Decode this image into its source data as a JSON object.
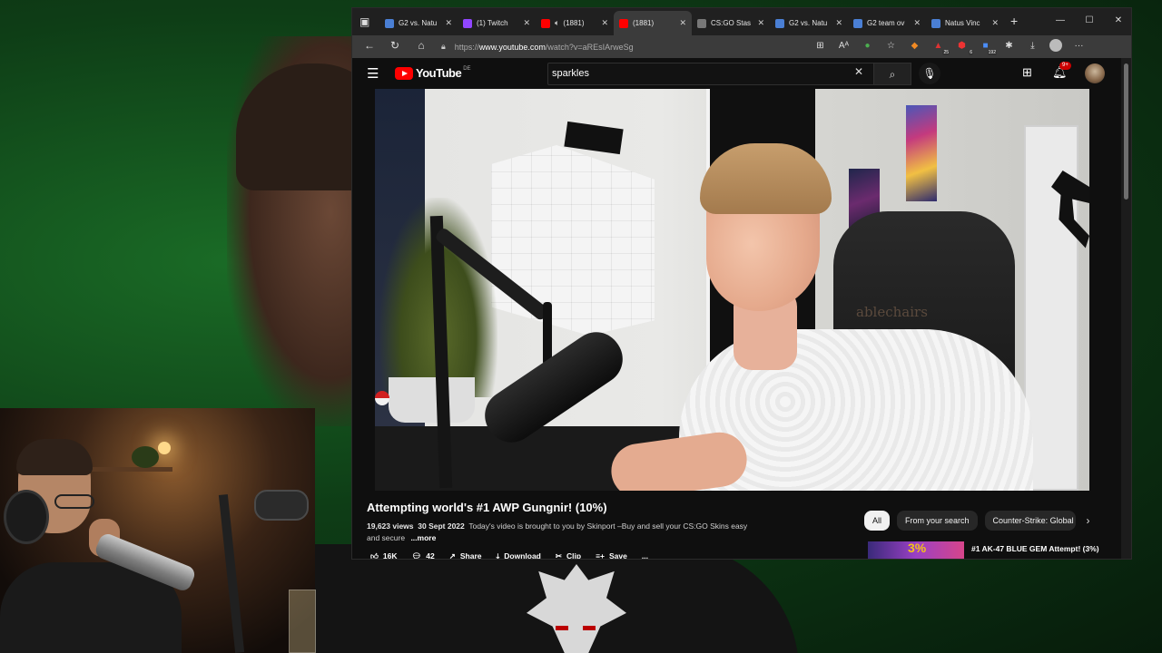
{
  "browser": {
    "tabs": [
      {
        "label": "G2 vs. Natu",
        "icon": "page-icon",
        "color": "#4a7fd4"
      },
      {
        "label": "(1) Twitch",
        "icon": "twitch-icon",
        "color": "#9146ff"
      },
      {
        "label": "(1881)",
        "icon": "youtube-icon",
        "color": "#ff0000",
        "muted": true
      },
      {
        "label": "(1881)",
        "icon": "youtube-icon",
        "color": "#ff0000",
        "active": true
      },
      {
        "label": "CS:GO Stas",
        "icon": "csgostash-icon",
        "color": "#777777"
      },
      {
        "label": "G2 vs. Natu",
        "icon": "page-icon",
        "color": "#4a7fd4"
      },
      {
        "label": "G2 team ov",
        "icon": "page-icon",
        "color": "#4a7fd4"
      },
      {
        "label": "Natus Vinc",
        "icon": "page-icon",
        "color": "#4a7fd4"
      }
    ],
    "url_prefix": "https://",
    "url_host": "www.youtube.com",
    "url_path": "/watch?v=aREsIArweSg",
    "extension_badges": {
      "ext_a": "25",
      "ext_b": "6",
      "ext_c": "192"
    }
  },
  "youtube": {
    "logo_text": "YouTube",
    "country_code": "DE",
    "search_value": "sparkles",
    "notification_count": "9+",
    "video": {
      "title": "Attempting world's #1 AWP Gungnir! (10%)",
      "views": "19,623 views",
      "date": "30 Sept 2022",
      "description": "Today's video is brought to you by Skinport –Buy and sell your CS:GO Skins easy and secure",
      "more_label": "...more",
      "chair_brand_text": "ablechairs"
    },
    "actions": {
      "likes": "16K",
      "comments": "42",
      "share": "Share",
      "download": "Download",
      "clip": "Clip",
      "save": "Save",
      "more": "..."
    },
    "chips": [
      "All",
      "From your search",
      "Counter-Strike: Global"
    ],
    "recommendation": {
      "thumb_text": "3%",
      "title": "#1 AK-47 BLUE GEM Attempt! (3%)"
    }
  }
}
